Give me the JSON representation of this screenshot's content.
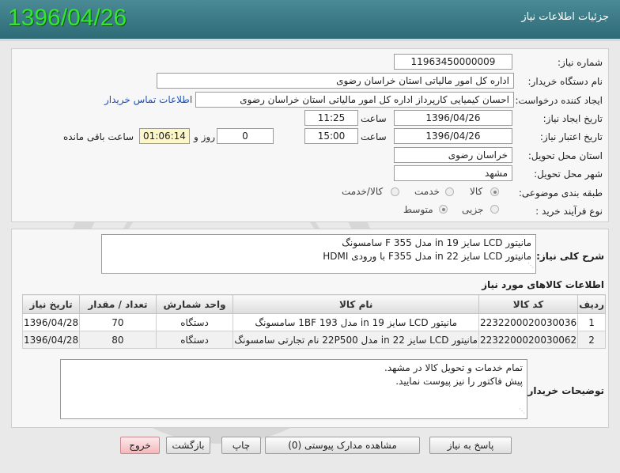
{
  "header": {
    "title": "جزئیات اطلاعات نیاز",
    "date_stamp": "1396/04/26"
  },
  "form": {
    "need_number": {
      "label": "شماره نیاز:",
      "value": "11963450000009"
    },
    "buyer_org": {
      "label": "نام دستگاه خریدار:",
      "value": "اداره کل امور مالیاتی استان خراسان رضوی"
    },
    "requester": {
      "label": "ایجاد کننده درخواست:",
      "value": "احسان کیمیایی کارپرداز اداره کل امور مالیاتی استان خراسان رضوی",
      "contact_link": "اطلاعات تماس خریدار"
    },
    "created": {
      "label": "تاریخ ایجاد نیاز:",
      "date": "1396/04/26",
      "time_label": "ساعت",
      "time": "11:25"
    },
    "validity": {
      "label": "تاریخ اعتبار نیاز:",
      "date": "1396/04/26",
      "time_label": "ساعت",
      "time": "15:00",
      "days": "0",
      "days_label": "روز و",
      "remaining": "01:06:14",
      "remaining_label": "ساعت باقی مانده"
    },
    "province": {
      "label": "استان محل تحویل:",
      "value": "خراسان رضوی"
    },
    "city": {
      "label": "شهر محل تحویل:",
      "value": "مشهد"
    },
    "category": {
      "label": "طبقه بندی موضوعی:",
      "options": [
        "کالا",
        "خدمت",
        "کالا/خدمت"
      ],
      "selected": "کالا"
    },
    "process": {
      "label": "نوع فرآیند خرید :",
      "options": [
        "جزیی",
        "متوسط"
      ],
      "selected": "متوسط"
    }
  },
  "summary": {
    "label": "شرح کلی نیاز:",
    "lines": [
      "مانیتور LCD سایز 19 in مدل F 355 سامسونگ",
      "مانیتور LCD سایز 22 in مدل F355 با ورودی HDMI"
    ]
  },
  "items_section": {
    "title": "اطلاعات کالاهای مورد نیاز",
    "columns": [
      "ردیف",
      "کد کالا",
      "نام کالا",
      "واحد شمارش",
      "تعداد / مقدار",
      "تاریخ نیاز"
    ],
    "rows": [
      [
        "1",
        "2232200020030036",
        "مانیتور LCD سایز 19 in مدل 193 1BF سامسونگ",
        "دستگاه",
        "70",
        "1396/04/28"
      ],
      [
        "2",
        "2232200020030062",
        "مانیتور LCD سایز 22 in مدل 22P500 نام تجارتی سامسونگ",
        "دستگاه",
        "80",
        "1396/04/28"
      ]
    ]
  },
  "buyer_notes": {
    "label": "توضیحات خریدار:",
    "lines": [
      "تمام خدمات و تحویل کالا در مشهد.",
      "پیش فاکتور را نیز پیوست نمایید."
    ]
  },
  "buttons": {
    "reply": "پاسخ به نیاز",
    "attachments": "مشاهده مدارک پیوستی (0)",
    "print": "چاپ",
    "back": "بازگشت",
    "exit": "خروج"
  }
}
